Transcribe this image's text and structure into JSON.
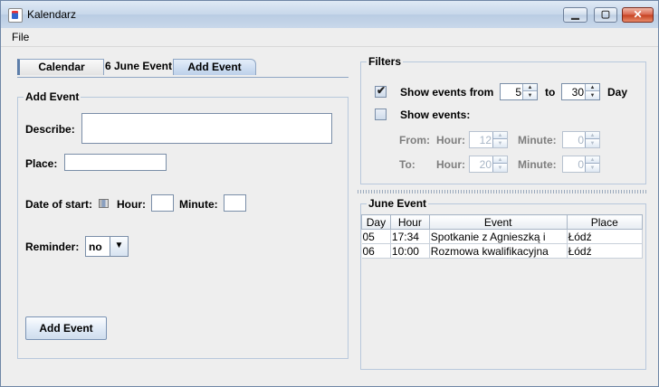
{
  "window": {
    "title": "Kalendarz"
  },
  "menu": {
    "file": "File"
  },
  "tabs": [
    {
      "label": "Calendar"
    },
    {
      "label": "6 June Event"
    },
    {
      "label": "Add Event",
      "selected": true
    }
  ],
  "add_event": {
    "group_title": "Add Event",
    "describe_label": "Describe:",
    "describe_value": "",
    "place_label": "Place:",
    "place_value": "",
    "date_label": "Date of start:",
    "hour_label": "Hour:",
    "hour_value": "",
    "minute_label": "Minute:",
    "minute_value": "",
    "reminder_label": "Reminder:",
    "reminder_value": "no",
    "submit_label": "Add Event"
  },
  "filters": {
    "group_title": "Filters",
    "show_from_label": "Show events from",
    "show_from_checked": true,
    "from_day": "5",
    "to_label": "to",
    "to_day": "30",
    "day_label": "Day",
    "show_events_label": "Show events:",
    "show_events_checked": false,
    "from_label": "From:",
    "to_row_label": "To:",
    "hour_label": "Hour:",
    "minute_label": "Minute:",
    "from_hour": "12",
    "from_minute": "0",
    "to_hour": "20",
    "to_minute": "0"
  },
  "june_event": {
    "group_title": "June Event",
    "columns": [
      "Day",
      "Hour",
      "Event",
      "Place"
    ],
    "rows": [
      [
        "05",
        "17:34",
        "Spotkanie z Agnieszką i",
        "Łódź"
      ],
      [
        "06",
        "10:00",
        "Rozmowa kwalifikacyjna",
        "Łódź"
      ]
    ]
  },
  "colors": {
    "accent": "#5d7ea9",
    "title_bar": "#c7d7ea",
    "close_button": "#c4401f"
  }
}
